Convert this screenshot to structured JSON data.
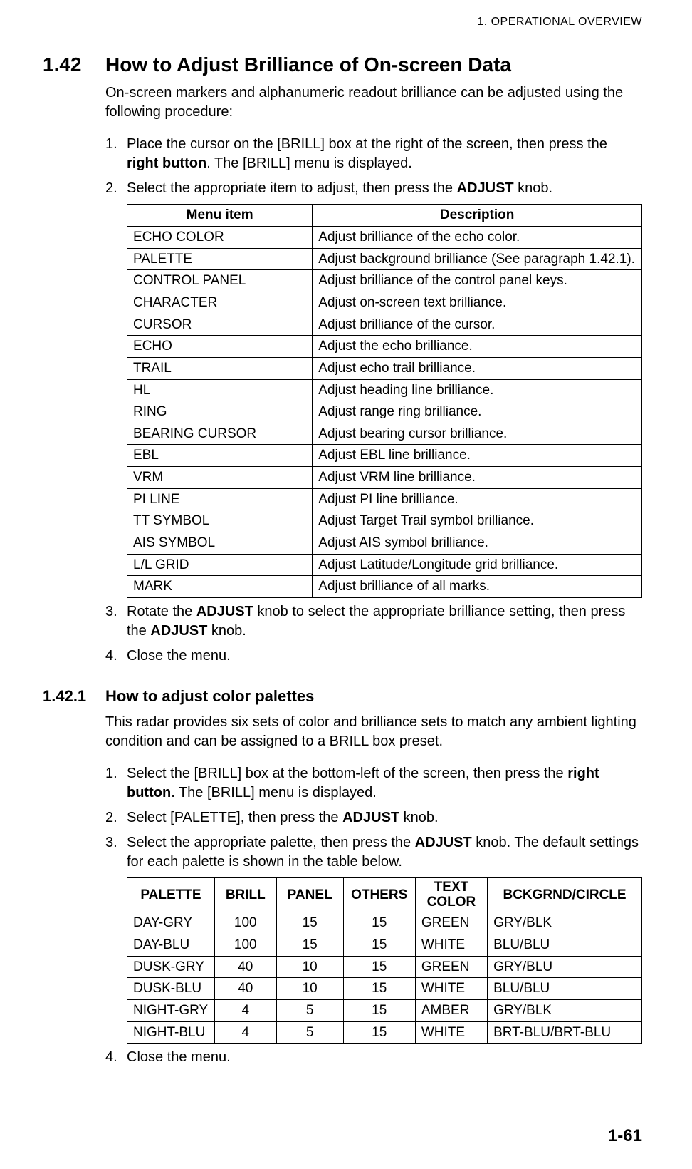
{
  "runningHead": "1.  OPERATIONAL OVERVIEW",
  "section": {
    "num": "1.42",
    "title": "How to Adjust Brilliance of On-screen Data",
    "intro": "On-screen markers and alphanumeric readout brilliance can be adjusted using the following procedure:",
    "steps": {
      "s1": {
        "mk": "1.",
        "a": "Place the cursor on the [BRILL] box at the right of the screen, then press the ",
        "b": "right button",
        "c": ". The [BRILL] menu is displayed."
      },
      "s2": {
        "mk": "2.",
        "a": "Select the appropriate item to adjust, then press the ",
        "b": "ADJUST",
        "c": " knob."
      },
      "s3": {
        "mk": "3.",
        "a": "Rotate the ",
        "b": "ADJUST",
        "c": " knob to select the appropriate brilliance setting, then press the ",
        "d": "ADJUST",
        "e": " knob."
      },
      "s4": {
        "mk": "4.",
        "a": "Close the menu."
      }
    }
  },
  "menuTable": {
    "headers": {
      "c1": "Menu item",
      "c2": "Description"
    },
    "rows": [
      {
        "c1": "ECHO COLOR",
        "c2": "Adjust brilliance of the echo color."
      },
      {
        "c1": "PALETTE",
        "c2": "Adjust background brilliance (See paragraph 1.42.1)."
      },
      {
        "c1": "CONTROL PANEL",
        "c2": "Adjust brilliance of the control panel keys."
      },
      {
        "c1": "CHARACTER",
        "c2": "Adjust on-screen text brilliance."
      },
      {
        "c1": "CURSOR",
        "c2": "Adjust brilliance of the cursor."
      },
      {
        "c1": "ECHO",
        "c2": "Adjust the echo brilliance."
      },
      {
        "c1": "TRAIL",
        "c2": "Adjust echo trail brilliance."
      },
      {
        "c1": "HL",
        "c2": "Adjust heading line brilliance."
      },
      {
        "c1": "RING",
        "c2": "Adjust range ring brilliance."
      },
      {
        "c1": "BEARING CURSOR",
        "c2": "Adjust bearing cursor brilliance."
      },
      {
        "c1": "EBL",
        "c2": "Adjust EBL line brilliance."
      },
      {
        "c1": "VRM",
        "c2": "Adjust VRM line brilliance."
      },
      {
        "c1": "PI LINE",
        "c2": "Adjust PI line brilliance."
      },
      {
        "c1": "TT SYMBOL",
        "c2": "Adjust Target Trail symbol brilliance."
      },
      {
        "c1": "AIS SYMBOL",
        "c2": "Adjust AIS symbol brilliance."
      },
      {
        "c1": "L/L GRID",
        "c2": "Adjust Latitude/Longitude grid brilliance."
      },
      {
        "c1": "MARK",
        "c2": "Adjust brilliance of all marks."
      }
    ]
  },
  "subsection": {
    "num": "1.42.1",
    "title": "How to adjust color palettes",
    "intro": "This radar provides six sets of color and brilliance sets to match any ambient lighting condition and can be assigned to a BRILL box preset.",
    "steps": {
      "s1": {
        "mk": "1.",
        "a": "Select the [BRILL] box at the bottom-left of the screen, then press the ",
        "b": "right button",
        "c": ". The [BRILL] menu is displayed."
      },
      "s2": {
        "mk": "2.",
        "a": "Select [PALETTE], then press the ",
        "b": "ADJUST",
        "c": " knob."
      },
      "s3": {
        "mk": "3.",
        "a": "Select the appropriate palette, then press the ",
        "b": "ADJUST",
        "c": " knob. The default settings for each palette is shown in the table below."
      },
      "s4": {
        "mk": "4.",
        "a": "Close the menu."
      }
    }
  },
  "paletteTable": {
    "headers": {
      "c1": "PALETTE",
      "c2": "BRILL",
      "c3": "PANEL",
      "c4": "OTHERS",
      "c5a": "TEXT",
      "c5b": "COLOR",
      "c6": "BCKGRND/CIRCLE"
    },
    "rows": [
      {
        "c1": "DAY-GRY",
        "c2": "100",
        "c3": "15",
        "c4": "15",
        "c5": "GREEN",
        "c6": "GRY/BLK"
      },
      {
        "c1": "DAY-BLU",
        "c2": "100",
        "c3": "15",
        "c4": "15",
        "c5": "WHITE",
        "c6": "BLU/BLU"
      },
      {
        "c1": "DUSK-GRY",
        "c2": "40",
        "c3": "10",
        "c4": "15",
        "c5": "GREEN",
        "c6": "GRY/BLU"
      },
      {
        "c1": "DUSK-BLU",
        "c2": "40",
        "c3": "10",
        "c4": "15",
        "c5": "WHITE",
        "c6": "BLU/BLU"
      },
      {
        "c1": "NIGHT-GRY",
        "c2": "4",
        "c3": "5",
        "c4": "15",
        "c5": "AMBER",
        "c6": "GRY/BLK"
      },
      {
        "c1": "NIGHT-BLU",
        "c2": "4",
        "c3": "5",
        "c4": "15",
        "c5": "WHITE",
        "c6": "BRT-BLU/BRT-BLU"
      }
    ]
  },
  "pageNumber": "1-61"
}
